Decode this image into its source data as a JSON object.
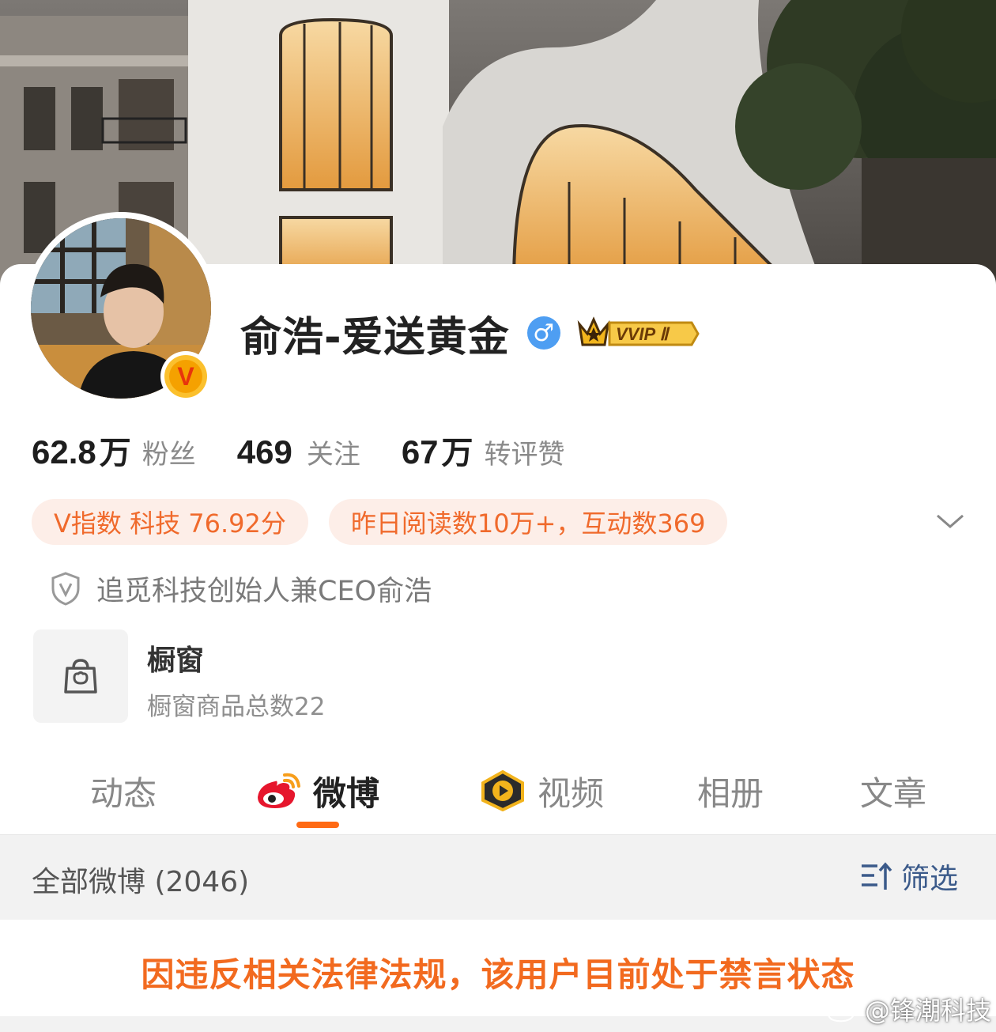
{
  "profile": {
    "name": "俞浩-爱送黄金",
    "gender_symbol": "♂",
    "vip_label": "VVIP Ⅱ",
    "verified_badge": "V"
  },
  "stats": [
    {
      "num": "62.8",
      "unit": "万",
      "label": "粉丝"
    },
    {
      "num": "469",
      "unit": "",
      "label": "关注"
    },
    {
      "num": "67",
      "unit": "万",
      "label": "转评赞"
    }
  ],
  "tags": [
    "V指数 科技 76.92分",
    "昨日阅读数10万+，互动数369"
  ],
  "verification": "追觅科技创始人兼CEO俞浩",
  "shop": {
    "title": "橱窗",
    "subtitle": "橱窗商品总数22"
  },
  "tabs": [
    "动态",
    "微博",
    "视频",
    "相册",
    "文章"
  ],
  "list": {
    "title": "全部微博 (2046)",
    "filter_label": "筛选"
  },
  "banned_notice": "因违反相关法律法规，该用户目前处于禁言状态",
  "watermark": "@锋潮科技",
  "colors": {
    "accent": "#f26a1f",
    "tag_bg": "#fdeee8",
    "filter_blue": "#3b5a8a"
  }
}
